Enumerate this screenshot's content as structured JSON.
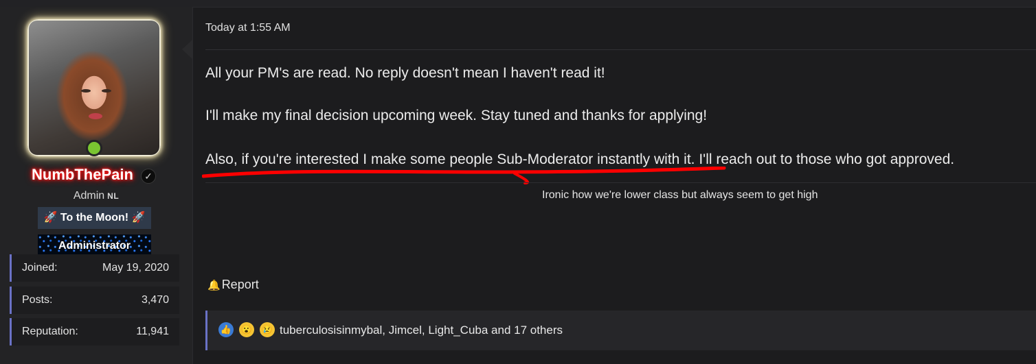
{
  "user": {
    "name": "NumbThePain",
    "title": "Admin",
    "title_flag": "NL",
    "banners": [
      "🚀 To the Moon! 🚀",
      "Administrator"
    ],
    "stats": [
      {
        "label": "Joined:",
        "value": "May 19, 2020"
      },
      {
        "label": "Posts:",
        "value": "3,470"
      },
      {
        "label": "Reputation:",
        "value": "11,941"
      }
    ]
  },
  "post": {
    "time": "Today at 1:55 AM",
    "paragraphs": [
      "All your PM's are read. No reply doesn't mean I haven't read it!",
      "I'll make my final decision upcoming week. Stay tuned and thanks for applying!",
      "Also, if you're interested I make some people Sub-Moderator instantly with it. I'll reach out to those who got approved."
    ],
    "signature": "Ironic how we're lower class but always seem to get high",
    "report_label": "Report",
    "reactions_text": "tuberculosisinmybal, Jimcel, Light_Cuba and 17 others"
  },
  "colors": {
    "online": "#7ac431",
    "accent_border": "#6a72c6",
    "underline": "#ff0000",
    "username_glow": "#ff1a1a"
  },
  "icons": [
    "verified-check-icon",
    "bell-icon",
    "like-reaction-icon",
    "wow-reaction-icon",
    "sad-reaction-icon"
  ]
}
